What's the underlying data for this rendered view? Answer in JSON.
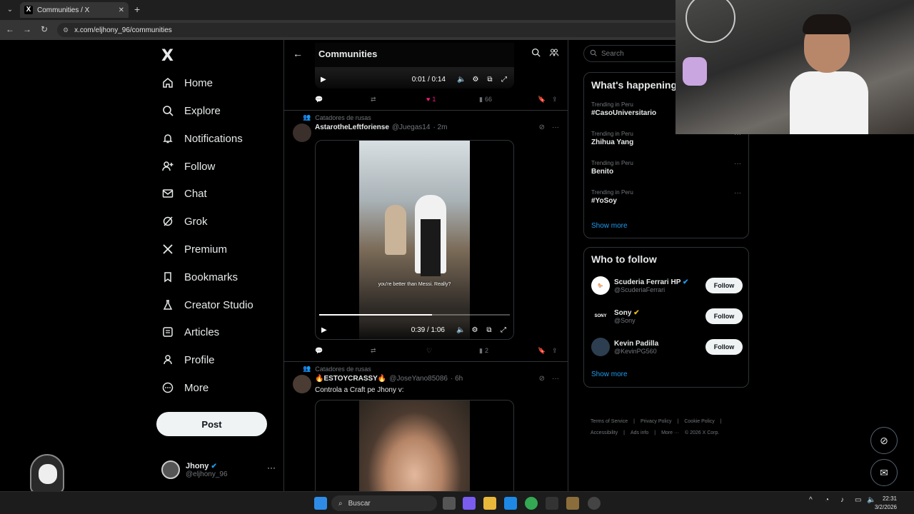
{
  "browser": {
    "tab_title": "Communities / X",
    "url": "x.com/eljhony_96/communities"
  },
  "nav": {
    "logo": "X",
    "items": [
      {
        "label": "Home",
        "icon": "home-icon"
      },
      {
        "label": "Explore",
        "icon": "search-icon"
      },
      {
        "label": "Notifications",
        "icon": "bell-icon"
      },
      {
        "label": "Follow",
        "icon": "person-add-icon"
      },
      {
        "label": "Chat",
        "icon": "mail-icon"
      },
      {
        "label": "Grok",
        "icon": "grok-icon"
      },
      {
        "label": "Premium",
        "icon": "x-logo-icon"
      },
      {
        "label": "Bookmarks",
        "icon": "bookmark-icon"
      },
      {
        "label": "Creator Studio",
        "icon": "flask-icon"
      },
      {
        "label": "Articles",
        "icon": "article-icon"
      },
      {
        "label": "Profile",
        "icon": "person-icon"
      },
      {
        "label": "More",
        "icon": "more-circle-icon"
      }
    ],
    "post_label": "Post",
    "account": {
      "name": "Jhony",
      "handle": "@eljhony_96"
    }
  },
  "main": {
    "title": "Communities",
    "top_video": {
      "time": "0:01 / 0:14",
      "likes": "1",
      "views": "66"
    },
    "post1": {
      "community": "Catadores de rusas",
      "name": "AstarotheLeftforiense",
      "handle": "@Juegas14",
      "time": "· 2m",
      "subtitle": "you're better than Messi. Really?",
      "video_time": "0:39 / 1:06",
      "progress": 0.59,
      "views": "2"
    },
    "post2": {
      "community": "Catadores de rusas",
      "name": "ESTOYCRASSY",
      "handle": "@JoseYano85086",
      "time": "· 6h",
      "text": "Controla a Craft pe Jhony v:"
    }
  },
  "right": {
    "search_placeholder": "Search",
    "happening_title": "What's happening",
    "trends": [
      {
        "meta": "Trending in Peru",
        "name": "#CasoUniversitario"
      },
      {
        "meta": "Trending in Peru",
        "name": "Zhihua Yang"
      },
      {
        "meta": "Trending in Peru",
        "name": "Benito"
      },
      {
        "meta": "Trending in Peru",
        "name": "#YoSoy"
      }
    ],
    "show_more": "Show more",
    "wtf_title": "Who to follow",
    "follow_suggestions": [
      {
        "name": "Scuderia Ferrari HP",
        "handle": "@ScuderiaFerrari",
        "button": "Follow"
      },
      {
        "name": "Sony",
        "handle": "@Sony",
        "button": "Follow"
      },
      {
        "name": "Kevin Padilla",
        "handle": "@KevinPG560",
        "button": "Follow"
      }
    ],
    "footer": [
      "Terms of Service",
      "|",
      "Privacy Policy",
      "|",
      "Cookie Policy",
      "|",
      "Accessibility",
      "|",
      "Ads info",
      "|",
      "More ···",
      "© 2026 X Corp."
    ]
  },
  "taskbar": {
    "search_label": "Buscar",
    "time": "22:31",
    "date": "3/2/2026"
  },
  "colors": {
    "accent": "#1d9bf0",
    "like": "#f91880",
    "bg": "#000000",
    "border": "#2f3336"
  }
}
